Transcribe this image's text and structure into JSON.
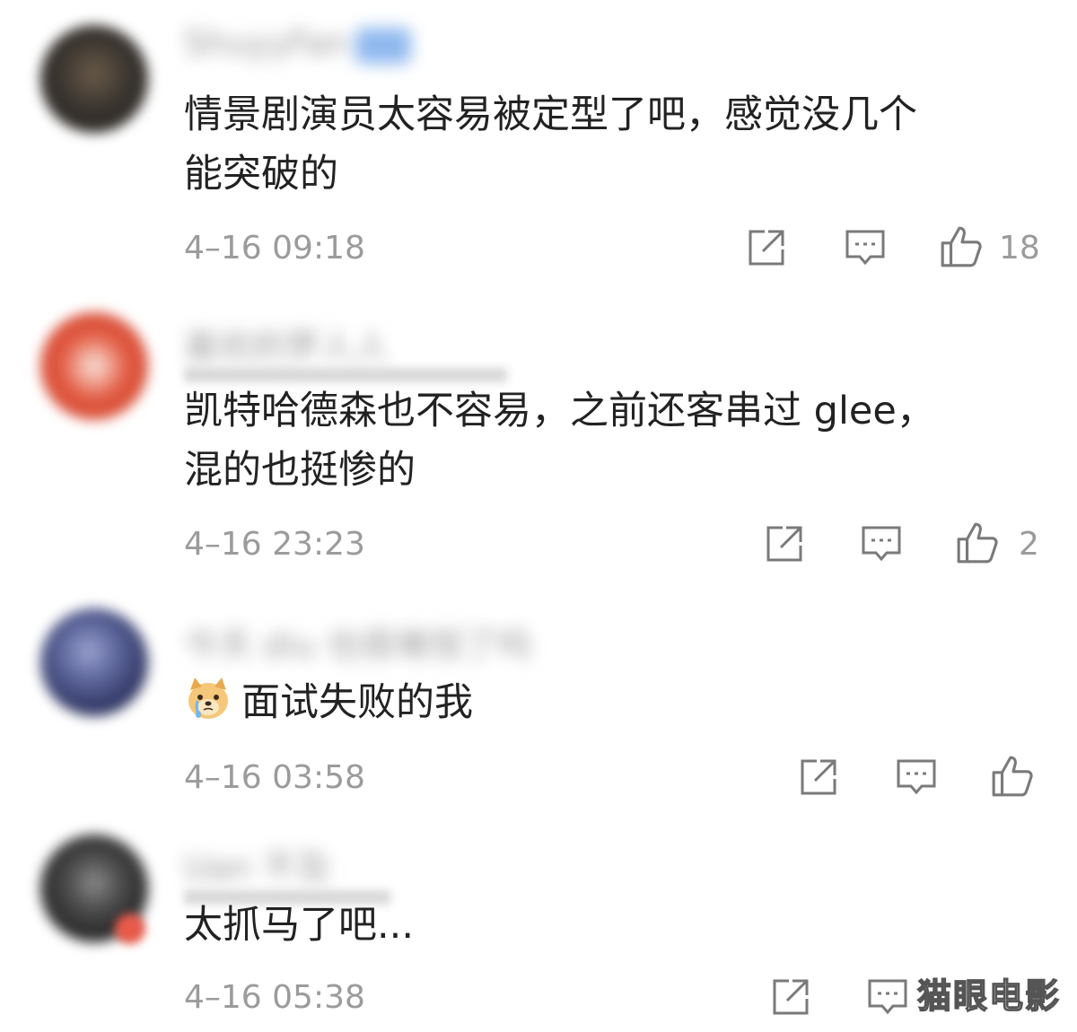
{
  "comments": [
    {
      "username": "ShuyyFan",
      "text_line1": "情景剧演员太容易被定型了吧，感觉没几个",
      "text_line2": "能突破的",
      "timestamp": "4–16 09:18",
      "like_count": "18",
      "avatar_color": "#3a3530"
    },
    {
      "username": "喜欢的罗人人",
      "text_line1": "凯特哈德森也不容易，之前还客串过 glee，",
      "text_line2": "混的也挺惨的",
      "timestamp": "4–16 23:23",
      "like_count": "2",
      "avatar_color": "#e0573f"
    },
    {
      "username": "今天 diu 也很难恒了吗",
      "emoji": "crying-dog-emoji",
      "text_line1": "面试失败的我",
      "timestamp": "4–16 03:58",
      "like_count": "",
      "avatar_color": "#3b4470"
    },
    {
      "username": "Uan 不及",
      "text_line1": "太抓马了吧...",
      "timestamp": "4–16 05:38",
      "avatar_color": "#2e2e2e"
    }
  ],
  "icons": {
    "share": "share-icon",
    "reply": "comment-icon",
    "like": "thumbs-up-icon"
  },
  "colors": {
    "meta_text": "#9b9b9b",
    "icon_stroke": "#7a7a7a"
  },
  "watermark": "猫眼电影"
}
